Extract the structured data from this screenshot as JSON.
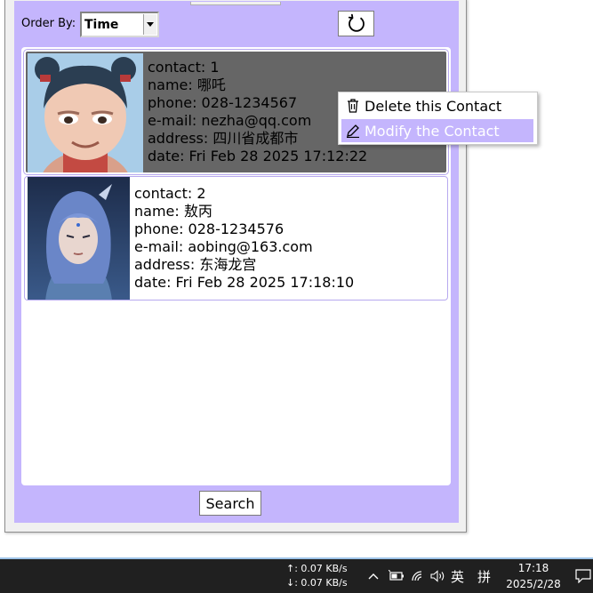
{
  "toolbar": {
    "order_by_label": "Order By:",
    "order_by_value": "Time",
    "refresh_icon": "refresh-icon"
  },
  "contacts": [
    {
      "contact": "contact: 1",
      "name": "name: 哪吒",
      "phone": "phone: 028-1234567",
      "email": "e-mail: nezha@qq.com",
      "address": "address: 四川省成都市",
      "date": "date: Fri Feb 28 2025 17:12:22",
      "selected": true
    },
    {
      "contact": "contact: 2",
      "name": "name: 敖丙",
      "phone": "phone: 028-1234576",
      "email": "e-mail: aobing@163.com",
      "address": "address: 东海龙宫",
      "date": "date: Fri Feb 28 2025 17:18:10",
      "selected": false
    }
  ],
  "context_menu": {
    "items": [
      {
        "label": "Delete this Contact",
        "icon": "trash-icon"
      },
      {
        "label": "Modify the Contact",
        "icon": "pencil-icon",
        "highlighted": true
      }
    ]
  },
  "search_button": "Search",
  "taskbar": {
    "upload": "↑: 0.07 KB/s",
    "download": "↓: 0.07 KB/s",
    "ime_lang": "英",
    "ime_mode": "拼",
    "time": "17:18",
    "date": "2025/2/28"
  },
  "colors": {
    "accent": "#c4b5fd",
    "selected_card": "#666666",
    "taskbar": "#202020"
  }
}
